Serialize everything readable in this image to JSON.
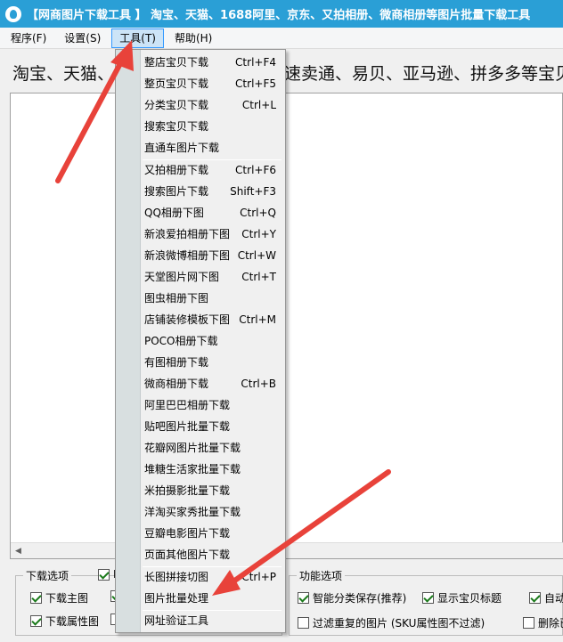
{
  "window": {
    "title": "【网商图片下载工具 】 淘宝、天猫、1688阿里、京东、又拍相册、微商相册等图片批量下载工具"
  },
  "menubar": [
    {
      "label": "程序(F)"
    },
    {
      "label": "设置(S)"
    },
    {
      "label": "工具(T)"
    },
    {
      "label": "帮助(H)"
    }
  ],
  "banner": {
    "left_text": "淘宝、天猫、",
    "right_text": "速卖通、易贝、亚马逊、拼多多等宝贝"
  },
  "tools_menu": {
    "items": [
      {
        "label": "整店宝贝下载",
        "shortcut": "Ctrl+F4"
      },
      {
        "label": "整页宝贝下载",
        "shortcut": "Ctrl+F5"
      },
      {
        "label": "分类宝贝下载",
        "shortcut": "Ctrl+L"
      },
      {
        "label": "搜索宝贝下载",
        "shortcut": ""
      },
      {
        "label": "直通车图片下载",
        "shortcut": ""
      },
      {
        "label": "又拍相册下载",
        "shortcut": "Ctrl+F6"
      },
      {
        "label": "搜索图片下载",
        "shortcut": "Shift+F3"
      },
      {
        "label": "QQ相册下图",
        "shortcut": "Ctrl+Q"
      },
      {
        "label": "新浪爱拍相册下图",
        "shortcut": "Ctrl+Y"
      },
      {
        "label": "新浪微博相册下图",
        "shortcut": "Ctrl+W"
      },
      {
        "label": "天堂图片网下图",
        "shortcut": "Ctrl+T"
      },
      {
        "label": "图虫相册下图",
        "shortcut": ""
      },
      {
        "label": "店铺装修模板下图",
        "shortcut": "Ctrl+M"
      },
      {
        "label": "POCO相册下载",
        "shortcut": ""
      },
      {
        "label": "有图相册下载",
        "shortcut": ""
      },
      {
        "label": "微商相册下载",
        "shortcut": "Ctrl+B"
      },
      {
        "label": "阿里巴巴相册下载",
        "shortcut": ""
      },
      {
        "label": "贴吧图片批量下载",
        "shortcut": ""
      },
      {
        "label": "花瓣网图片批量下载",
        "shortcut": ""
      },
      {
        "label": "堆糖生活家批量下载",
        "shortcut": ""
      },
      {
        "label": "米拍摄影批量下载",
        "shortcut": ""
      },
      {
        "label": "洋淘买家秀批量下载",
        "shortcut": ""
      },
      {
        "label": "豆瓣电影图片下载",
        "shortcut": ""
      },
      {
        "label": "页面其他图片下载",
        "shortcut": ""
      },
      {
        "label": "长图拼接切图",
        "shortcut": "Ctrl+P"
      },
      {
        "label": "图片批量处理",
        "shortcut": ""
      },
      {
        "label": "网址验证工具",
        "shortcut": ""
      }
    ]
  },
  "download_options": {
    "title": "下载选项",
    "header_partial": "R",
    "options": [
      {
        "label": "下载主图",
        "checked": true
      },
      {
        "label": "下载属性图",
        "checked": true
      }
    ]
  },
  "function_options": {
    "title": "功能选项",
    "options": [
      {
        "label": "智能分类保存(推荐)",
        "checked": true
      },
      {
        "label": "显示宝贝标题",
        "checked": true
      },
      {
        "label": "自动",
        "checked": true
      },
      {
        "label": "过滤重复的图片 (SKU属性图不过滤)",
        "checked": false
      },
      {
        "label": "删除已",
        "checked": false
      }
    ]
  },
  "annotation_color": "#e8423a"
}
